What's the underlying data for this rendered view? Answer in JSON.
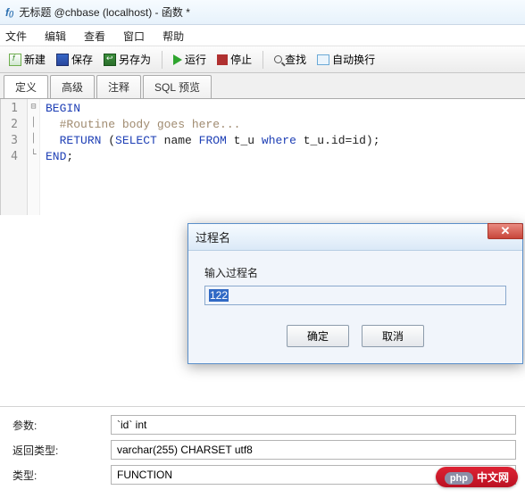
{
  "title": "无标题 @chbase (localhost) - 函数 *",
  "menu": {
    "file": "文件",
    "edit": "编辑",
    "view": "查看",
    "window": "窗口",
    "help": "帮助"
  },
  "toolbar": {
    "new": "新建",
    "save": "保存",
    "saveas": "另存为",
    "run": "运行",
    "stop": "停止",
    "find": "查找",
    "wrap": "自动换行"
  },
  "tabs": {
    "define": "定义",
    "advanced": "高级",
    "comment": "注释",
    "sql": "SQL 预览"
  },
  "code": {
    "l1_begin": "BEGIN",
    "l2_cmt": "#Routine body goes here...",
    "l3a": "RETURN (SELECT name FROM t_u where t_u.id=id);",
    "l3_return": "RETURN",
    "l3_select": "SELECT",
    "l3_from": "FROM",
    "l3_where": "where",
    "l4_end": "END",
    "semi": ";"
  },
  "dialog": {
    "title": "过程名",
    "label": "输入过程名",
    "value": "122",
    "ok": "确定",
    "cancel": "取消"
  },
  "bottom": {
    "params_label": "参数:",
    "params_value": "`id` int",
    "rettype_label": "返回类型:",
    "rettype_value": "varchar(255) CHARSET utf8",
    "type_label": "类型:",
    "type_value": "FUNCTION"
  },
  "badge": {
    "php": "php",
    "site": "中文网"
  }
}
